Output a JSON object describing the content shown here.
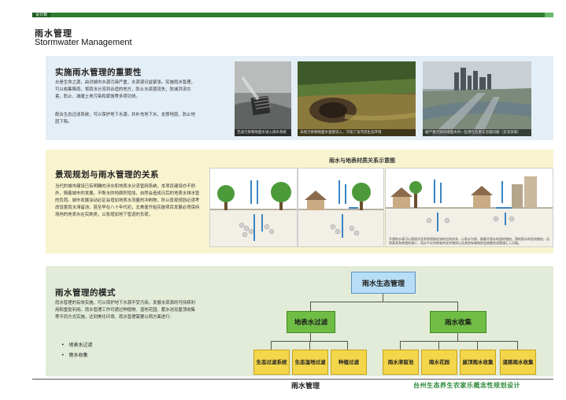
{
  "header": {
    "tag": "设计篇"
  },
  "title": {
    "cn": "雨水管理",
    "en": "Stormwater Management"
  },
  "section1": {
    "heading": "实施雨水管理的重要性",
    "para1": "水是生命之源，由对城市水源污染严重，水资源日益紧张。实施雨水管理，可以收集降雨，将雨水分流到合适的地方，防止水资源流失，防减洪涝灾害，防止、减缓土地污染和腐蚀等多项功效。",
    "para2": "配合生态过滤系统，可以保护地下水源，并补充地下水，支撑地层，防止地层下陷。",
    "photos": [
      {
        "caption": "无滤污染物地面水进入排水系统"
      },
      {
        "caption": "未经污染物地面水直接流入，污染了该河流生态环境"
      },
      {
        "caption": "被严重污染的地面水的一些潜在危害与治理问题（支流流域）"
      }
    ]
  },
  "section2": {
    "heading": "景观规划与雨水管理的关系",
    "para": "当代的城市建设已有明确的涉水和地表水分流管网系统。本项目建设亦不例外，随着城市的发展，不断水的地面积增加，自然会造成日后的地表水排水管的负荷。城市发展涂动必定会增加地表水流量的冲刷物，所以景观规划必须考虑设置雨水滞留池，甚至早在八十年代初，北美便开始实施项目发展必须保持场地的地表水在实刷类，以免增加地下管道的负荷。",
    "diagram_title": "雨水与地表材质关系示意图",
    "diagram_note": "不透地水表可以直接涉及到渗透和径流的比例关系。以雨水为例，随着不透水地面的增加，落地雨水的径流增加，自然蒸发和渗透的减少，而从平水所带来的化学物质以及其他有毒物质会随着径流直接汇入河道。"
  },
  "section3": {
    "heading": "雨水管理的模式",
    "para": "雨水管理的有效实施，可以保护地下水源不受污染，发展水资源的可持续利用和重复利用。雨水管理工作可通过种植物、湿地花园、蓄水池及屋顶收集等不同方式实施，达到美化环境、雨水管理需要以两方面进行：",
    "bullets": [
      "地表水过滤",
      "雨水收集"
    ]
  },
  "tree": {
    "root": "雨水生态管理",
    "left": "地表水过滤",
    "right": "雨水收集",
    "left_children": [
      "生态过滤系统",
      "生态湿地过滤",
      "种植过滤"
    ],
    "right_children": [
      "雨水滞留池",
      "雨水花园",
      "屋顶雨水收集",
      "道路雨水收集"
    ]
  },
  "footer": {
    "center": "雨水管理",
    "right": "台州生态养生农家乐概念性规划设计"
  },
  "colors": {
    "accent_green": "#2e7d32",
    "node_blue": "#b7def6",
    "node_green": "#6fbd45",
    "node_yellow": "#f4d64a"
  }
}
